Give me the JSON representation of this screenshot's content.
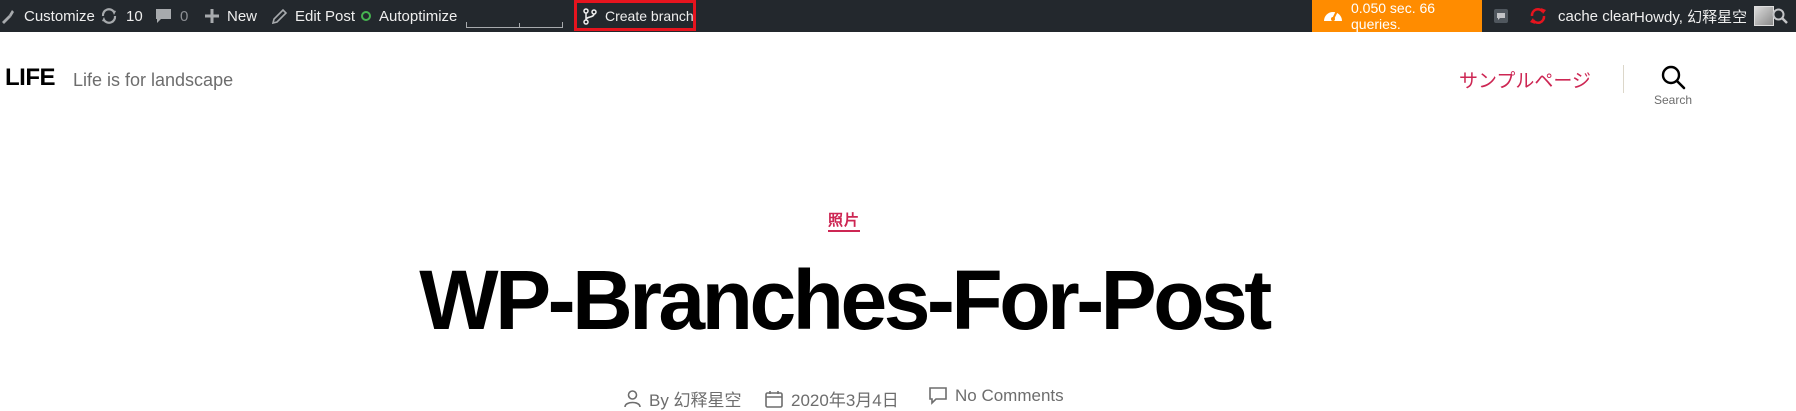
{
  "adminbar": {
    "customize": "Customize",
    "updates_count": "10",
    "comments_count": "0",
    "new": "New",
    "edit_post": "Edit Post",
    "autoptimize": "Autoptimize",
    "create_branch": "Create branch",
    "performance": "0.050 sec. 66 queries.",
    "cache_clear": "cache clear",
    "howdy": "Howdy, 幻释星空",
    "icons": [
      "customize-icon",
      "updates-icon",
      "comments-icon",
      "plus-icon",
      "pencil-icon",
      "status-ring-icon",
      "branch-icon",
      "dashboard-gauge-icon",
      "notification-icon",
      "refresh-icon",
      "avatar",
      "search-icon"
    ],
    "colors": {
      "bar": "#23282d",
      "perf_bg": "#ff8c00",
      "ring": "#46b450",
      "highlight": "#e6141e",
      "refresh": "#e6141e"
    }
  },
  "site": {
    "title": "LIFE",
    "description": "Life is for landscape"
  },
  "nav": {
    "menu_item": "サンプルページ",
    "search_label": "Search"
  },
  "post": {
    "category": "照片",
    "title": "WP-Branches-For-Post",
    "author": "By 幻释星空",
    "date": "2020年3月4日",
    "comments": "No Comments"
  },
  "accent_color": "#cd2653"
}
